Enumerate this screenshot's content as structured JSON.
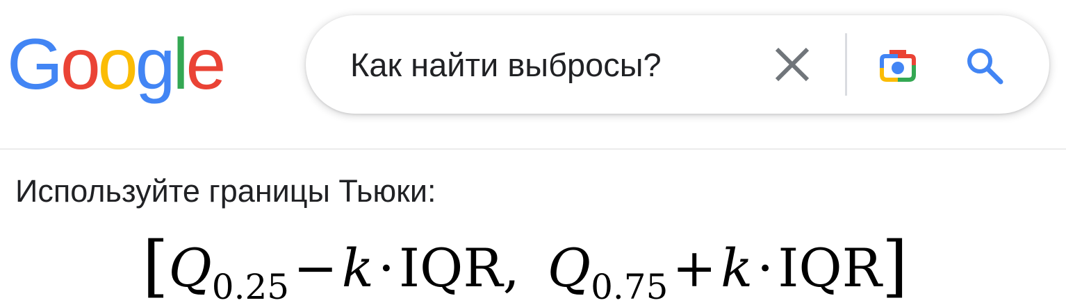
{
  "header": {
    "logo": {
      "letters": [
        "G",
        "o",
        "o",
        "g",
        "l",
        "e"
      ],
      "colors": [
        "#4285F4",
        "#EA4335",
        "#FBBC05",
        "#4285F4",
        "#34A853",
        "#EA4335"
      ]
    },
    "search": {
      "value": "Как найти выбросы?"
    },
    "icons": {
      "clear": "close-icon",
      "lens": "camera-lens-icon",
      "search": "search-icon"
    }
  },
  "result": {
    "intro": "Используйте границы Тьюки:",
    "formula": {
      "open_bracket": "[",
      "q_symbol": "Q",
      "q_low_sub": "0.25",
      "minus": "−",
      "k": "k",
      "dot": "·",
      "iqr": "IQR",
      "comma": ",",
      "q_high_sub": "0.75",
      "plus": "+",
      "close_bracket": "]"
    }
  },
  "colors": {
    "text": "#202124",
    "icon_gray": "#70757a",
    "search_blue": "#4285F4"
  }
}
